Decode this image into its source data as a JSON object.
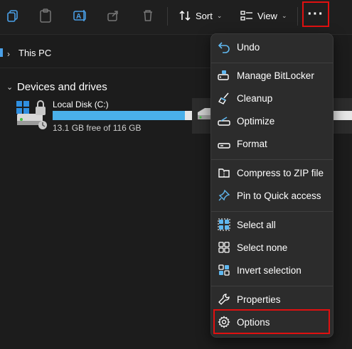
{
  "toolbar": {
    "sort_label": "Sort",
    "view_label": "View",
    "more_label": "···",
    "icons": [
      "copy-icon",
      "paste-icon",
      "rename-icon",
      "share-icon",
      "delete-icon",
      "sort-icon",
      "view-icon"
    ]
  },
  "address": {
    "location": "This PC"
  },
  "group": {
    "title": "Devices and drives"
  },
  "drive": {
    "name": "Local Disk (C:)",
    "free_text": "13.1 GB free of 116 GB",
    "used_fraction": 0.887
  },
  "menu": {
    "items": [
      {
        "label": "Undo",
        "icon": "undo-icon"
      },
      {
        "label": "Manage BitLocker",
        "icon": "bitlocker-icon"
      },
      {
        "label": "Cleanup",
        "icon": "broom-icon"
      },
      {
        "label": "Optimize",
        "icon": "optimize-icon"
      },
      {
        "label": "Format",
        "icon": "format-icon"
      },
      {
        "label": "Compress to ZIP file",
        "icon": "zip-icon"
      },
      {
        "label": "Pin to Quick access",
        "icon": "pin-icon"
      },
      {
        "label": "Select all",
        "icon": "select-all-icon"
      },
      {
        "label": "Select none",
        "icon": "select-none-icon"
      },
      {
        "label": "Invert selection",
        "icon": "invert-selection-icon"
      },
      {
        "label": "Properties",
        "icon": "wrench-icon"
      },
      {
        "label": "Options",
        "icon": "gear-icon"
      }
    ]
  },
  "colors": {
    "accent": "#4ab0ea",
    "highlight": "#e01010",
    "menu_bg": "#2c2c2c",
    "background": "#1c1c1c"
  }
}
